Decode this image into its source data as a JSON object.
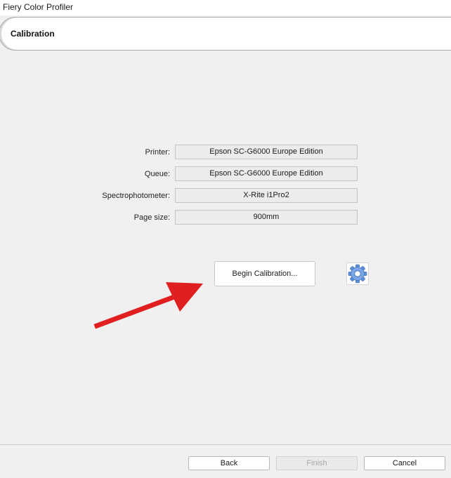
{
  "window": {
    "title": "Fiery Color Profiler"
  },
  "header": {
    "title": "Calibration"
  },
  "fields": [
    {
      "label": "Printer:",
      "value": "Epson SC-G6000 Europe Edition"
    },
    {
      "label": "Queue:",
      "value": "Epson SC-G6000 Europe Edition"
    },
    {
      "label": "Spectrophotometer:",
      "value": "X-Rite i1Pro2"
    },
    {
      "label": "Page size:",
      "value": "900mm"
    }
  ],
  "actions": {
    "begin_label": "Begin Calibration...",
    "settings_icon": "gear-icon"
  },
  "annotation": {
    "arrow_color": "#e02020"
  },
  "footer": {
    "back_label": "Back",
    "finish_label": "Finish",
    "cancel_label": "Cancel",
    "finish_enabled": false
  },
  "colors": {
    "background": "#f0f0f0",
    "gear": "#5b8fd6"
  }
}
